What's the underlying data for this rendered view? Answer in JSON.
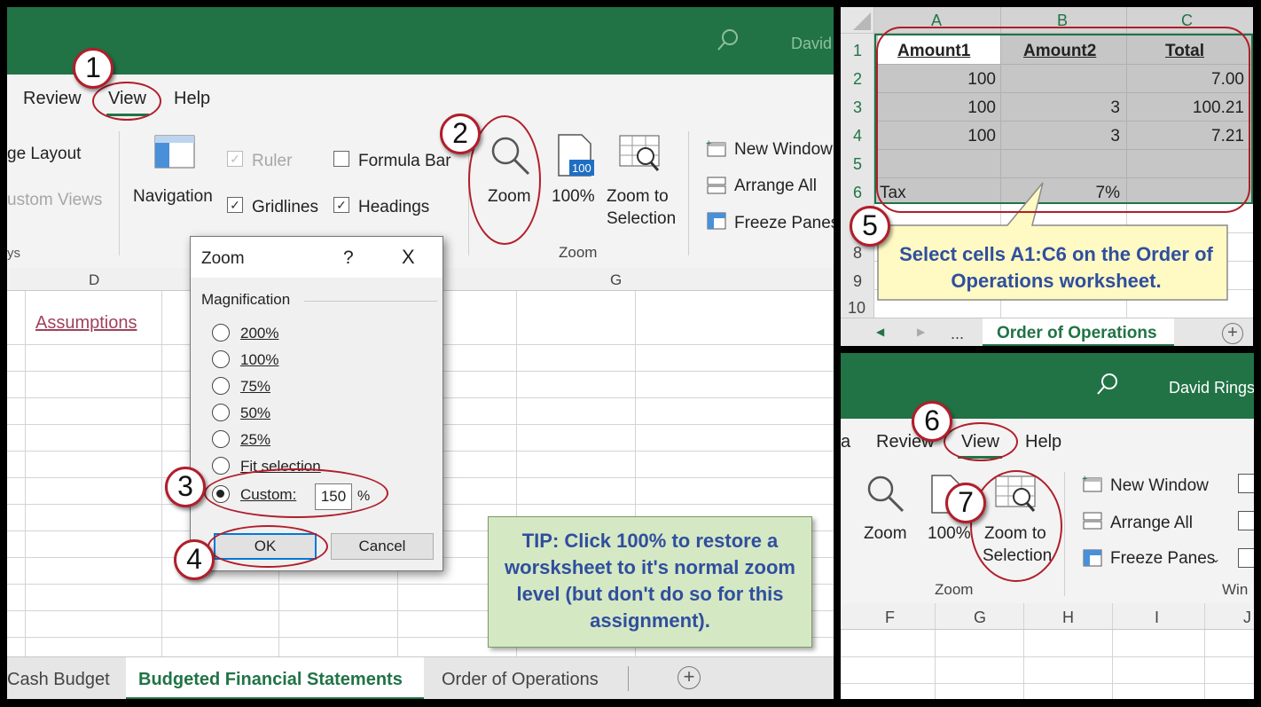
{
  "left": {
    "user_name": "David",
    "menu": {
      "review": "Review",
      "view": "View",
      "help": "Help"
    },
    "ribbon": {
      "page_layout": "ge Layout",
      "custom_views": "ustom Views",
      "group_fragment": "ys",
      "navigation": "Navigation",
      "ruler": "Ruler",
      "gridlines": "Gridlines",
      "formula_bar": "Formula Bar",
      "headings": "Headings",
      "zoom": "Zoom",
      "hundred": "100%",
      "hundred_icon": "100",
      "zoom_to": "Zoom to",
      "selection": "Selection",
      "zoom_group": "Zoom",
      "new_window": "New Window",
      "arrange_all": "Arrange All",
      "freeze_panes": "Freeze Panes"
    },
    "columns": {
      "d": "D",
      "g": "G"
    },
    "cell_link": "Assumptions",
    "dialog": {
      "title": "Zoom",
      "help": "?",
      "close": "X",
      "section": "Magnification",
      "options": [
        "200%",
        "100%",
        "75%",
        "50%",
        "25%",
        "Fit selection"
      ],
      "custom_label": "Custom:",
      "custom_value": "150",
      "percent": "%",
      "ok": "OK",
      "cancel": "Cancel"
    },
    "tip": "TIP: Click 100% to restore a worsksheet to it's normal zoom level (but don't do so for this assignment).",
    "tabs": {
      "cash": "Cash Budget",
      "active": "Budgeted Financial Statements",
      "order": "Order of Operations",
      "add": "+"
    }
  },
  "top_right": {
    "columns": [
      "A",
      "B",
      "C"
    ],
    "rows": [
      "1",
      "2",
      "3",
      "4",
      "5",
      "6",
      "7",
      "8",
      "9",
      "10"
    ],
    "headers": [
      "Amount1",
      "Amount2",
      "Total"
    ],
    "data": [
      [
        "100",
        "",
        "7.00"
      ],
      [
        "100",
        "3",
        "100.21"
      ],
      [
        "100",
        "3",
        "7.21"
      ],
      [
        "",
        "",
        ""
      ],
      [
        "Tax",
        "7%",
        ""
      ]
    ],
    "callout": "Select cells A1:C6 on the Order of Operations worksheet.",
    "nav": {
      "prev": "◀",
      "next": "▶",
      "more": "...",
      "active_tab": "Order of Operations",
      "add": "+"
    }
  },
  "bottom_right": {
    "user_name": "David Rings",
    "menu": {
      "a": "a",
      "review": "Review",
      "view": "View",
      "help": "Help"
    },
    "ribbon": {
      "zoom": "Zoom",
      "hundred": "100%",
      "zoom_to": "Zoom to",
      "selection": "Selection",
      "new_window": "New Window",
      "arrange_all": "Arrange All",
      "freeze_panes": "Freeze Panes",
      "zoom_group": "Zoom",
      "window_group": "Win"
    },
    "columns": [
      "F",
      "G",
      "H",
      "I",
      "J"
    ]
  },
  "badges": [
    "1",
    "2",
    "3",
    "4",
    "5",
    "6",
    "7"
  ],
  "colors": {
    "excel_green": "#217346",
    "annotation_red": "#b01e2a",
    "tip_bg": "#d5e8c4",
    "callout_bg": "#fff9c4",
    "callout_text": "#2f4f9e"
  }
}
